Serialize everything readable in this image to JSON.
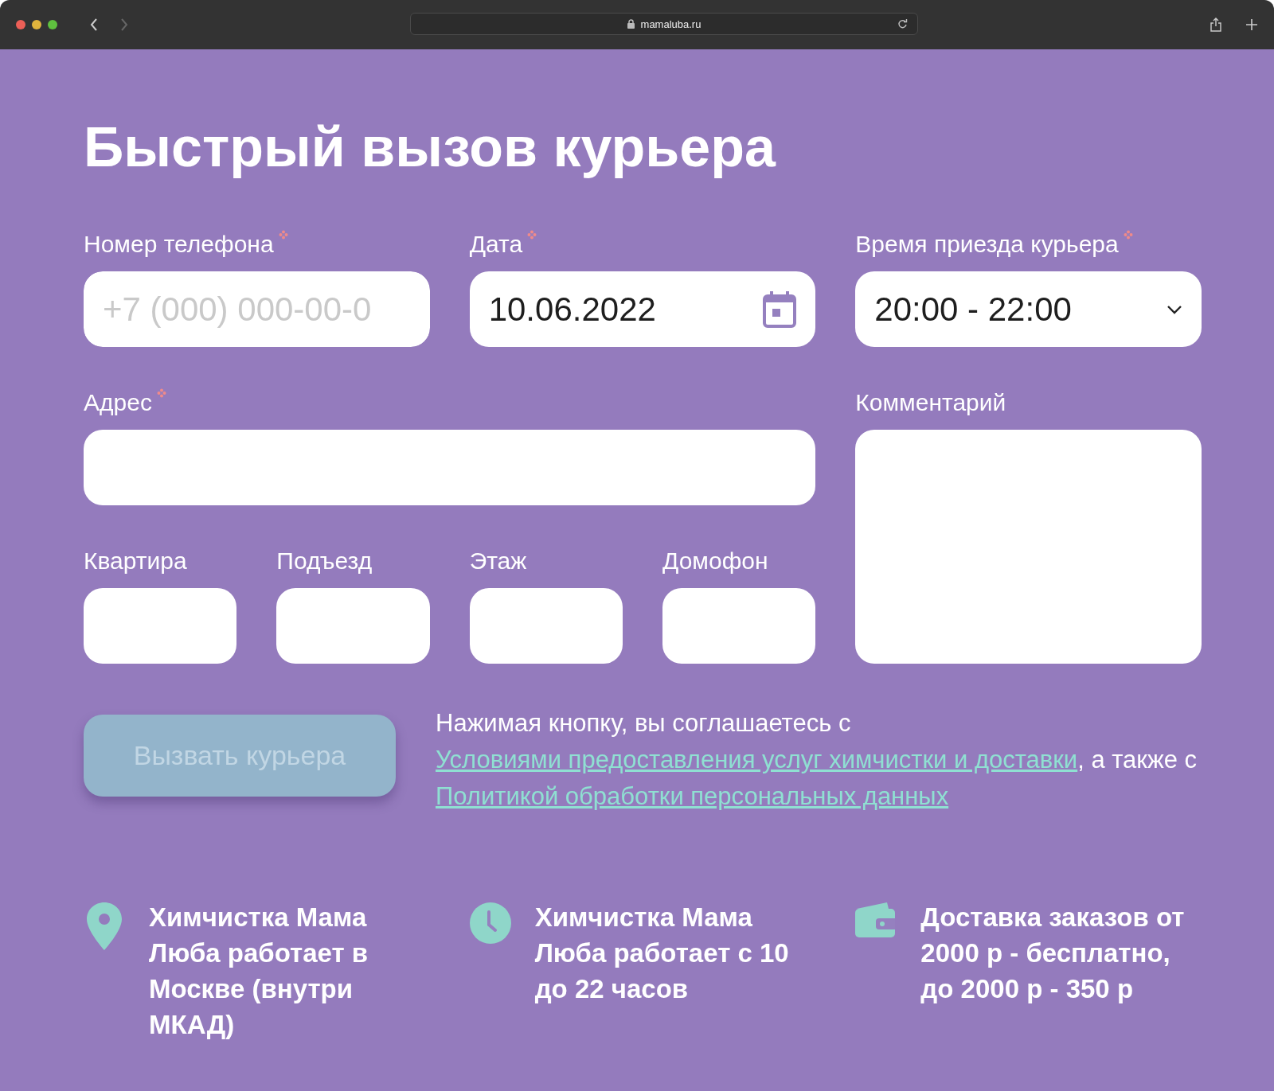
{
  "browser": {
    "url": "mamaluba.ru"
  },
  "title": "Быстрый вызов курьера",
  "fields": [
    {
      "kind": "phone",
      "label": "Номер телефона",
      "required": true,
      "placeholder": "+7 (000) 000-00-0"
    },
    {
      "kind": "date",
      "label": "Дата",
      "required": true,
      "value": "10.06.2022"
    },
    {
      "kind": "select",
      "label": "Время приезда курьера",
      "required": true,
      "value": "20:00 - 22:00"
    },
    {
      "kind": "wide",
      "label": "Адрес",
      "required": true
    },
    {
      "kind": "textarea",
      "label": "Комментарий",
      "required": false
    },
    {
      "kind": "short",
      "label": "Квартира",
      "required": false
    },
    {
      "kind": "short",
      "label": "Подъезд",
      "required": false
    },
    {
      "kind": "short",
      "label": "Этаж",
      "required": false
    },
    {
      "kind": "short",
      "label": "Домофон",
      "required": false
    }
  ],
  "submit": {
    "label": "Вызвать курьера",
    "disabled": true
  },
  "consent": {
    "before": "Нажимая кнопку, вы соглашаетесь с",
    "link1": "Условиями предоставления услуг химчистки и доставки",
    "middle": ", а также с",
    "link2": "Политикой обработки персональных данных"
  },
  "info": [
    {
      "kind": "location",
      "text": "Химчистка Мама Люба работает в Москве (внутри МКАД)"
    },
    {
      "kind": "clock",
      "text": "Химчистка Мама Люба работает с 10 до 22 часов"
    },
    {
      "kind": "wallet",
      "text": "Доставка заказов от 2000 р - бесплатно, до 2000 р - 350 р"
    }
  ]
}
